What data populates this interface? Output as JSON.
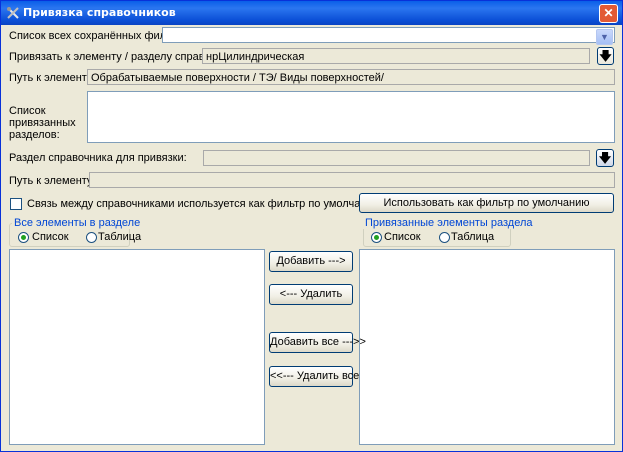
{
  "window": {
    "title": "Привязка справочников",
    "close_glyph": "✕"
  },
  "filters": {
    "label": "Список всех сохранённых фильтров:",
    "value": ""
  },
  "bind_to": {
    "label": "Привязать к элементу / разделу справочника:",
    "value": "нрЦилиндрическая"
  },
  "path1": {
    "label": "Путь к элементу:",
    "value": "Обрабатываемые поверхности / ТЭ/ Виды поверхностей/"
  },
  "bound_sections": {
    "label_lines": [
      "Список",
      "привязанных",
      "разделов:"
    ]
  },
  "section": {
    "label": "Раздел справочника для привязки:",
    "value": ""
  },
  "path2": {
    "label": "Путь к элементу:",
    "value": ""
  },
  "default_filter": {
    "checkbox_label": "Связь между справочниками используется как фильтр по умолчанию",
    "checked": false,
    "button_label": "Использовать как фильтр по умолчанию"
  },
  "left_group": {
    "title": "Все элементы в разделе",
    "opt_list": "Список",
    "opt_table": "Таблица",
    "selected": "list"
  },
  "right_group": {
    "title": "Привязанные элементы раздела",
    "opt_list": "Список",
    "opt_table": "Таблица",
    "selected": "list"
  },
  "actions": {
    "add": "Добавить --->",
    "remove": "<--- Удалить",
    "add_all": "Добавить все --->>",
    "remove_all": "<<--- Удалить все"
  },
  "icons": {
    "app": "tools-icon",
    "add": "arrow-down-icon",
    "dropdown": "chevron-down-icon"
  }
}
